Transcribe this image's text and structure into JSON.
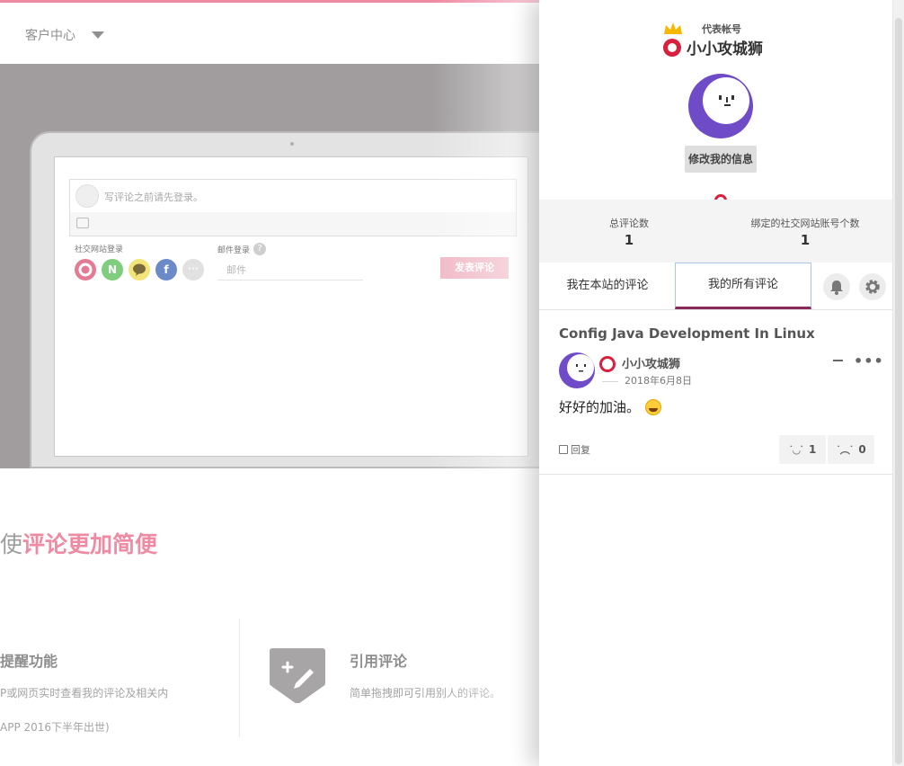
{
  "background_page": {
    "nav": {
      "customer_center": "客户中心"
    },
    "comment_widget": {
      "placeholder": "写评论之前请先登录。",
      "social_login_label": "社交网站登录",
      "email_login_label": "邮件登录",
      "help_icon": "?",
      "email_placeholder": "邮件",
      "submit_label": "发表评论",
      "social_icons": [
        "weibo-icon",
        "naver-icon",
        "kakao-icon",
        "facebook-icon",
        "more-icon"
      ],
      "social_icon_text": {
        "n": "N",
        "more": "···",
        "facebook": "f"
      }
    },
    "slogan": {
      "prefix": "使",
      "highlight": "评论更加简便"
    },
    "features": [
      {
        "title": "提醒功能",
        "desc1": "P或网页实时查看我的评论及相关内",
        "desc2": "APP 2016下半年出世)"
      },
      {
        "title": "引用评论",
        "desc": "简单拖拽即可引用别人的评论。"
      }
    ]
  },
  "panel": {
    "account_label": "代表帐号",
    "nickname": "小小攻城狮",
    "edit_button": "修改我的信息",
    "stats": [
      {
        "label": "总评论数",
        "value": "1"
      },
      {
        "label": "绑定的社交网站账号个数",
        "value": "1"
      }
    ],
    "tabs": [
      {
        "label": "我在本站的评论",
        "active": false
      },
      {
        "label": "我的所有评论",
        "active": true
      }
    ],
    "comment": {
      "title": "Config Java Development In Linux",
      "author": "小小攻城狮",
      "date": "2018年6月8日",
      "text": "好好的加油。",
      "reply_label": "回复",
      "likes": "1",
      "dislikes": "0"
    }
  },
  "colors": {
    "brand_pink": "#ef8aa3",
    "avatar_purple": "#6f4bc8",
    "logo_red": "#d8203f"
  }
}
